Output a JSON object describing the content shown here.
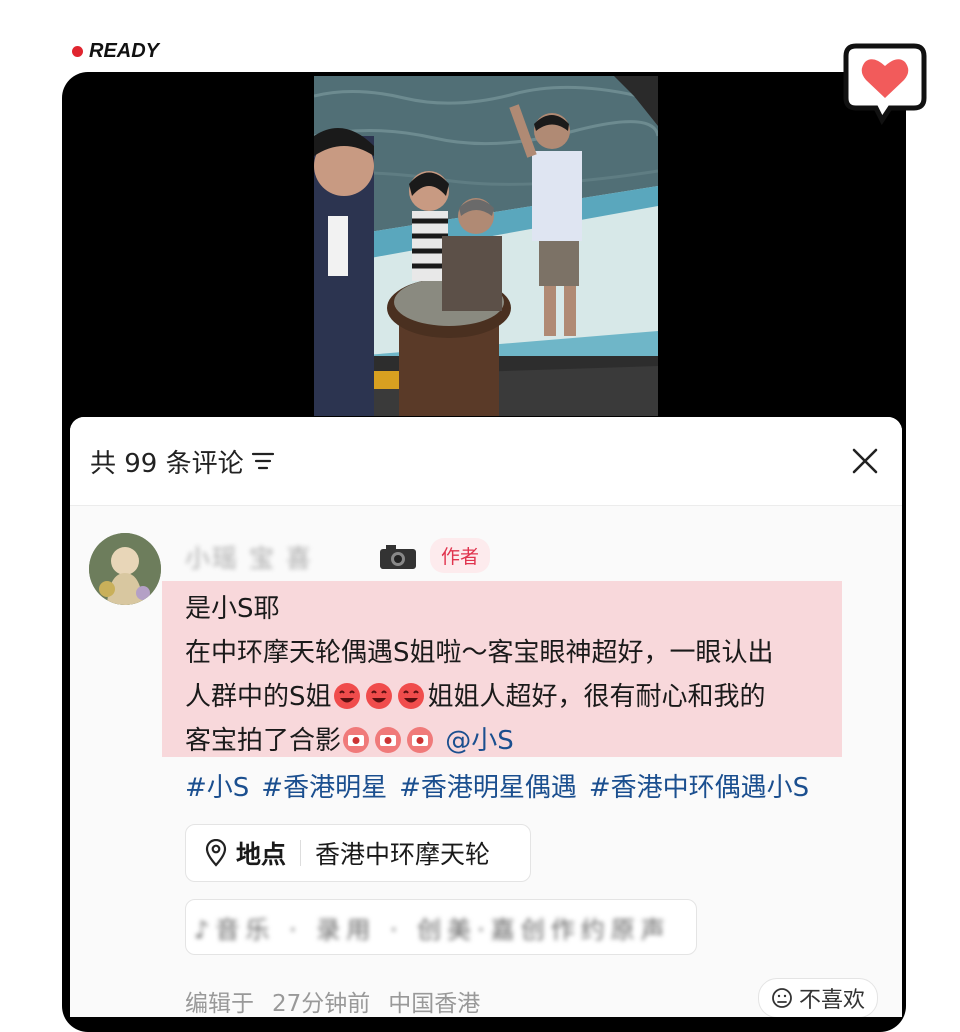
{
  "status": {
    "label": "READY",
    "dot_color": "#e0252f"
  },
  "comments_sheet": {
    "title": "共 99 条评论",
    "sort_icon": "filter-lines-icon",
    "close_icon": "close-icon"
  },
  "comment": {
    "username": "小瑶 宝 喜",
    "author_badge": "作者",
    "lines": [
      "是小S耶",
      "在中环摩天轮偶遇S姐啦～客宝眼神超好，一眼认出",
      "人群中的S姐",
      "姐姐人超好，很有耐心和我的",
      "客宝拍了合影",
      "@小S"
    ],
    "hashtags": [
      "#小S",
      "#香港明星",
      "#香港明星偶遇",
      "#香港中环偶遇小S"
    ],
    "location_label": "地点",
    "location_value": "香港中环摩天轮",
    "music_text": "♪音乐 · 录用 · 创美·嘉创作约原声",
    "edited_label": "编辑于",
    "edited_time": "27分钟前",
    "edited_location": "中国香港",
    "dislike_label": "不喜欢"
  },
  "colors": {
    "accent": "#e0344e",
    "link": "#1b4f8f",
    "highlight": "#f6aab0"
  }
}
